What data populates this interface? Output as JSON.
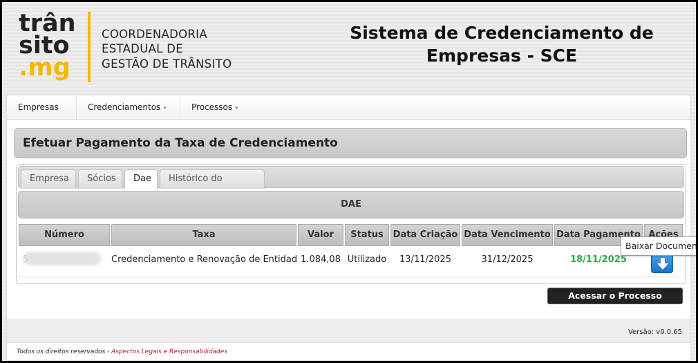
{
  "header": {
    "logo": [
      "trân",
      "sito",
      ".mg"
    ],
    "org_lines": [
      "COORDENADORIA",
      "ESTADUAL DE",
      "GESTÃO DE TRÂNSITO"
    ],
    "system_title_line1": "Sistema de Credenciamento de",
    "system_title_line2": "Empresas - SCE"
  },
  "menu": {
    "items": [
      {
        "label": "Empresas",
        "has_dropdown": false
      },
      {
        "label": "Credenciamentos",
        "has_dropdown": true
      },
      {
        "label": "Processos",
        "has_dropdown": true
      }
    ]
  },
  "page": {
    "title": "Efetuar Pagamento da Taxa de Credenciamento",
    "tabs": [
      {
        "label": "Empresa",
        "active": false
      },
      {
        "label": "Sócios",
        "active": false
      },
      {
        "label": "Dae",
        "active": true
      },
      {
        "label": "Histórico do Processo",
        "active": false
      }
    ],
    "section_title": "DAE",
    "table": {
      "headers": [
        "Número",
        "Taxa",
        "Valor",
        "Status",
        "Data Criação",
        "Data Vencimento",
        "Data Pagamento",
        "Ações"
      ],
      "rows": [
        {
          "numero": "5",
          "taxa": "Credenciamento e Renovação de Entidade",
          "valor": "1.084,08",
          "status": "Utilizado",
          "data_criacao": "13/11/2025",
          "data_vencimento": "31/12/2025",
          "data_pagamento": "18/11/2025"
        }
      ]
    },
    "tooltip": "Baixar Documento",
    "main_process_button": "Acessar o Processo Principal"
  },
  "footer": {
    "version": "Versão: v0.0.65",
    "rights_text": "Todos os direitos reservados - ",
    "rights_link": "Aspectos Legais e Responsabilidades"
  },
  "colors": {
    "brand_yellow": "#f5b800",
    "paid_green": "#2fa34a",
    "download_blue": "#1d72c9",
    "link_red": "#b01818"
  },
  "icons": {
    "download": "download-arrow-icon",
    "dropdown": "chevron-down-icon"
  }
}
